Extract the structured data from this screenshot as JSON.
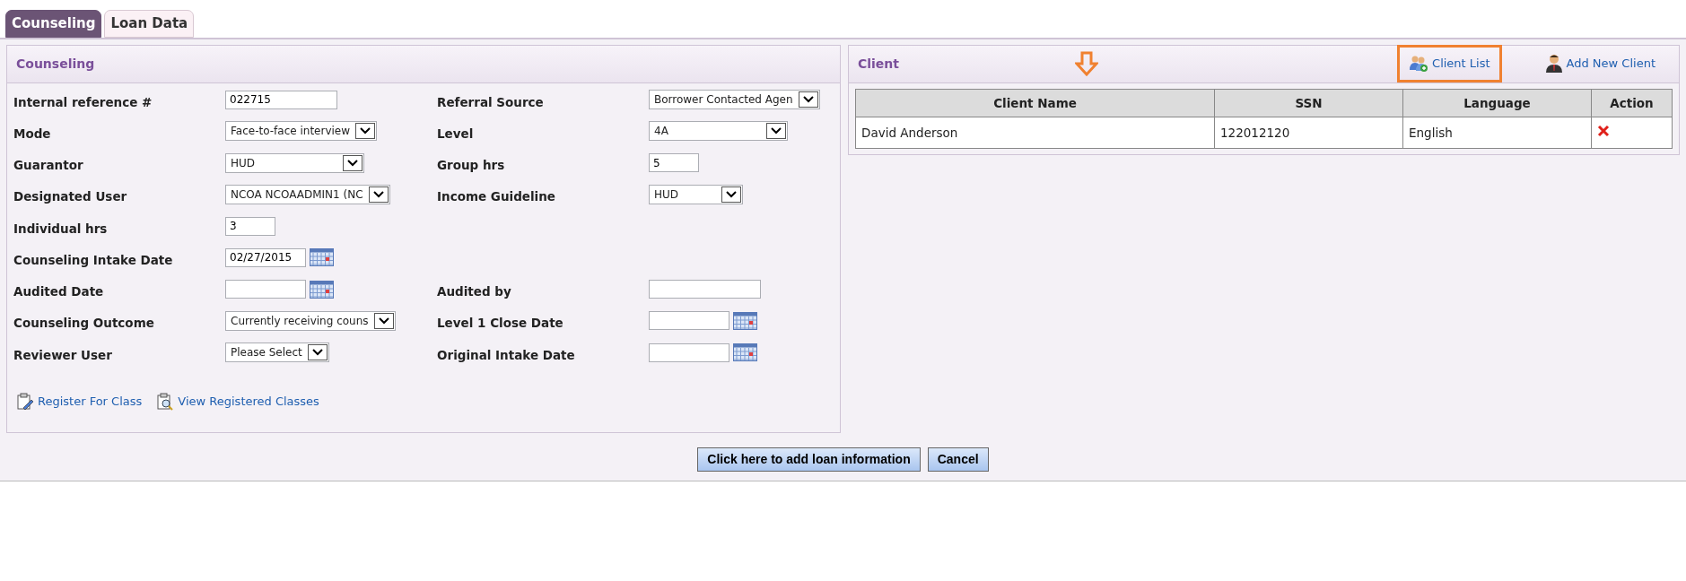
{
  "tabs": [
    {
      "label": "Counseling",
      "selected": true
    },
    {
      "label": "Loan Data",
      "selected": false
    }
  ],
  "counseling": {
    "title": "Counseling",
    "rows": [
      {
        "left": {
          "label": "Internal reference #",
          "kind": "text",
          "value": "022715"
        },
        "right": {
          "label": "Referral Source",
          "kind": "select",
          "value": "Borrower Contacted Agen"
        }
      },
      {
        "left": {
          "label": "Mode",
          "kind": "select",
          "value": "Face-to-face interview"
        },
        "right": {
          "label": "Level",
          "kind": "select",
          "value": "4A"
        }
      },
      {
        "left": {
          "label": "Guarantor",
          "kind": "select",
          "value": "HUD"
        },
        "right": {
          "label": "Group hrs",
          "kind": "text",
          "value": "5"
        }
      },
      {
        "left": {
          "label": "Designated User",
          "kind": "select",
          "value": "NCOA NCOAADMIN1 (NC"
        },
        "right": {
          "label": "Income Guideline",
          "kind": "select",
          "value": "HUD"
        }
      },
      {
        "left": {
          "label": "Individual hrs",
          "kind": "text",
          "value": "3"
        }
      },
      {
        "left": {
          "label": "Counseling Intake Date",
          "kind": "date",
          "value": "02/27/2015"
        }
      },
      {
        "left": {
          "label": "Audited Date",
          "kind": "date"
        },
        "right": {
          "label": "Audited by",
          "kind": "text"
        }
      },
      {
        "left": {
          "label": "Counseling Outcome",
          "kind": "select",
          "value": "Currently receiving couns"
        },
        "right": {
          "label": "Level 1 Close Date",
          "kind": "date"
        }
      },
      {
        "left": {
          "label": "Reviewer User",
          "kind": "select",
          "value": "Please Select"
        },
        "right": {
          "label": "Original Intake Date",
          "kind": "date"
        }
      }
    ],
    "links": [
      {
        "label": "Register For Class",
        "kind": "register"
      },
      {
        "label": "View Registered Classes",
        "kind": "view"
      }
    ]
  },
  "client": {
    "title": "Client",
    "actions": [
      {
        "label": "Client List",
        "kind": "list",
        "highlighted": true
      },
      {
        "label": "Add New Client",
        "kind": "add",
        "highlighted": false
      }
    ],
    "columns": [
      "Client Name",
      "SSN",
      "Language",
      "Action"
    ],
    "rows": [
      {
        "name": "David Anderson",
        "ssn": "122012120",
        "language": "English"
      }
    ]
  },
  "buttons": [
    "Click here to add loan information",
    "Cancel"
  ]
}
